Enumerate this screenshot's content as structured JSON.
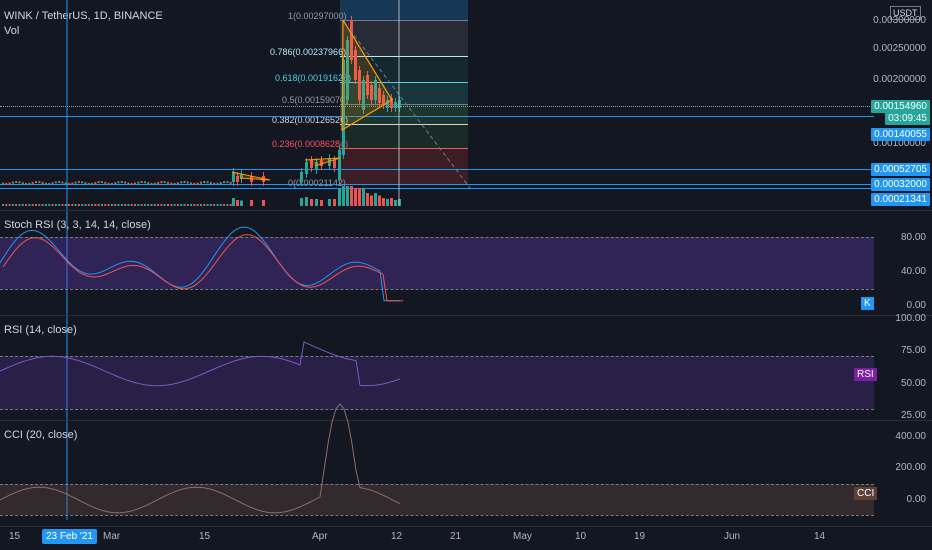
{
  "header": {
    "symbol": "WINK / TetherUS, 1D, BINANCE",
    "vol_label": "Vol",
    "currency": "USDT"
  },
  "price_axis": {
    "labels": [
      "0.00300000",
      "0.00250000",
      "0.00200000",
      "0.00100000"
    ],
    "current_price": "0.00154960",
    "countdown": "03:09:45",
    "tags": [
      "0.00140055",
      "0.00052705",
      "0.00032000",
      "0.00021341"
    ]
  },
  "fib_levels": [
    {
      "label": "1(0.00297000)",
      "color": "#9598a1"
    },
    {
      "label": "0.786(0.00237966)",
      "color": "#b2ebf2"
    },
    {
      "label": "0.618(0.00191628)",
      "color": "#4dd0e1"
    },
    {
      "label": "0.5(0.00159070)",
      "color": "#9598a1"
    },
    {
      "label": "0.382(0.00126526)",
      "color": "#d1d4dc"
    },
    {
      "label": "0.236(0.00086284)",
      "color": "#f7525f"
    },
    {
      "label": "0(0.00021142)",
      "color": "#9598a1"
    }
  ],
  "stoch_rsi": {
    "title": "Stoch RSI (3, 3, 14, 14, close)",
    "axis": [
      "80.00",
      "40.00",
      "0.00"
    ],
    "badge": "K",
    "badge_color": "#2196f3"
  },
  "rsi": {
    "title": "RSI (14, close)",
    "axis": [
      "100.00",
      "75.00",
      "50.00",
      "25.00"
    ],
    "badge": "RSI",
    "badge_color": "#7b1fa2"
  },
  "cci": {
    "title": "CCI (20, close)",
    "axis": [
      "400.00",
      "200.00",
      "0.00"
    ],
    "badge": "CCI",
    "badge_color": "#5d4037"
  },
  "time_axis": {
    "labels": [
      "15",
      "Mar",
      "15",
      "Apr",
      "12",
      "21",
      "May",
      "10",
      "19",
      "Jun",
      "14"
    ],
    "crosshair_date": "23 Feb '21"
  },
  "colors": {
    "up": "#26a69a",
    "down": "#ef5350",
    "accent": "#2196f3",
    "trend": "#ff9800"
  }
}
